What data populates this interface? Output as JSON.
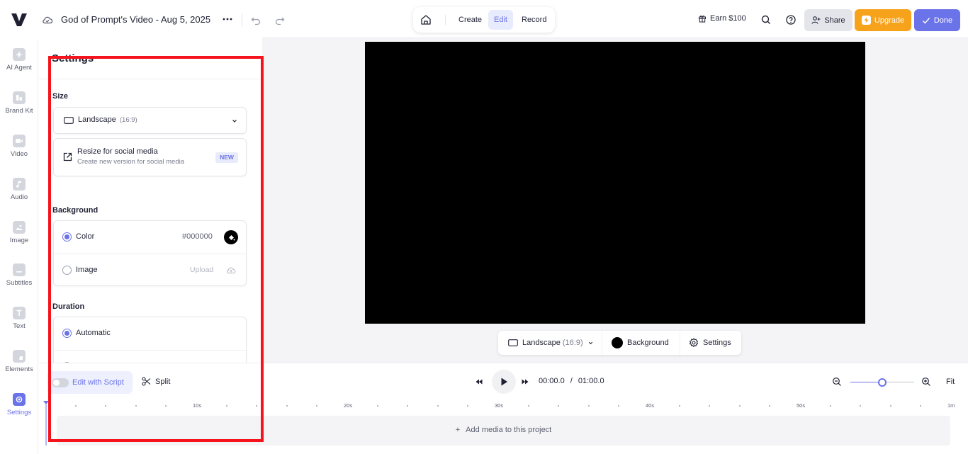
{
  "header": {
    "project_title": "God of Prompt's Video - Aug 5, 2025",
    "modes": {
      "create": "Create",
      "edit": "Edit",
      "record": "Record"
    },
    "earn_label": "Earn $100",
    "share_label": "Share",
    "upgrade_label": "Upgrade",
    "done_label": "Done"
  },
  "sidebar": {
    "items": [
      {
        "label": "AI Agent",
        "icon": "sparkle-icon"
      },
      {
        "label": "Brand Kit",
        "icon": "brand-kit-icon"
      },
      {
        "label": "Video",
        "icon": "video-icon"
      },
      {
        "label": "Audio",
        "icon": "music-note-icon"
      },
      {
        "label": "Image",
        "icon": "image-icon"
      },
      {
        "label": "Subtitles",
        "icon": "subtitles-icon"
      },
      {
        "label": "Text",
        "icon": "text-icon"
      },
      {
        "label": "Elements",
        "icon": "elements-icon"
      },
      {
        "label": "Settings",
        "icon": "settings-icon",
        "active": true
      }
    ]
  },
  "settings": {
    "title": "Settings",
    "size": {
      "label": "Size",
      "selected": "Landscape",
      "ratio": "(16:9)",
      "resize_title": "Resize for social media",
      "resize_subtitle": "Create new version for social media",
      "badge": "NEW"
    },
    "background": {
      "label": "Background",
      "color_option": "Color",
      "color_value": "#000000",
      "image_option": "Image",
      "upload_label": "Upload",
      "selected": "color"
    },
    "duration": {
      "label": "Duration",
      "automatic_option": "Automatic"
    }
  },
  "canvas_toolbar": {
    "size_label": "Landscape",
    "size_ratio": "(16:9)",
    "background_label": "Background",
    "settings_label": "Settings"
  },
  "timeline": {
    "edit_with_script": "Edit with Script",
    "split": "Split",
    "current_time": "00:00.0",
    "separator": "/",
    "total_time": "01:00.0",
    "fit_label": "Fit",
    "zoom_level": 0.5,
    "ruler_labels": [
      "10s",
      "20s",
      "30s",
      "40s",
      "50s",
      "1m"
    ],
    "add_media": "Add media to this project"
  },
  "colors": {
    "accent": "#6b73e8",
    "upgrade": "#f7a21b",
    "highlight": "#f5141d",
    "video_bg": "#000000"
  }
}
